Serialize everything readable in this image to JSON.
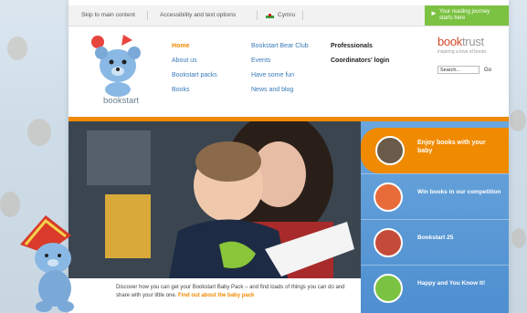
{
  "topbar": {
    "skip": "Skip to main content",
    "accessibility": "Accessibility and text options",
    "language": "Cymru"
  },
  "journey": {
    "label": "Your reading journey starts here"
  },
  "logo": {
    "word": "bookstart"
  },
  "nav": {
    "col1": [
      "Home",
      "About us",
      "Bookstart packs",
      "Books"
    ],
    "col2": [
      "Bookstart Bear Club",
      "Events",
      "Have some fun",
      "News and blog"
    ],
    "col3": [
      "Professionals",
      "Coordinators' login"
    ]
  },
  "booktrust": {
    "name_a": "book",
    "name_b": "trust",
    "tagline": "inspiring a love of books"
  },
  "search": {
    "placeholder": "Search...",
    "go": "Go"
  },
  "side_panels": [
    {
      "label": "Enjoy books with your baby"
    },
    {
      "label": "Win books in our competition"
    },
    {
      "label": "Bookstart 25"
    },
    {
      "label": "Happy and You Know It!"
    }
  ],
  "caption": {
    "text": "Discover how you can get your Bookstart Baby Pack – and find loads of things you can do and share with your little one.",
    "link": "Find out about the baby pack"
  },
  "colors": {
    "orange": "#f08a00",
    "green": "#7cc242",
    "blue": "#4f8fd0",
    "link": "#3a7ab8"
  }
}
